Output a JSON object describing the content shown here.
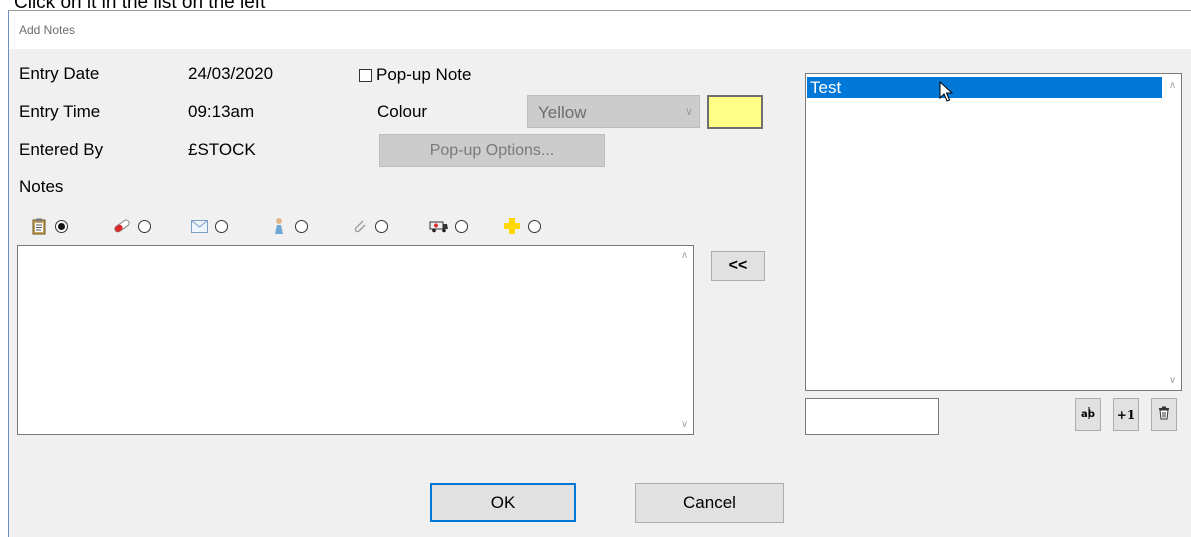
{
  "caption": "Click on it in the list on the left",
  "window": {
    "title": "Add Notes"
  },
  "fields": {
    "entry_date_label": "Entry Date",
    "entry_date_value": "24/03/2020",
    "entry_time_label": "Entry Time",
    "entry_time_value": "09:13am",
    "entered_by_label": "Entered By",
    "entered_by_value": "£STOCK",
    "notes_label": "Notes"
  },
  "popup": {
    "checkbox_label": "Pop-up Note",
    "checked": false,
    "colour_label": "Colour",
    "colour_value": "Yellow",
    "colour_swatch": "#ffff88",
    "options_label": "Pop-up Options..."
  },
  "categories": [
    {
      "icon": "clipboard-icon",
      "selected": true
    },
    {
      "icon": "pill-icon",
      "selected": false
    },
    {
      "icon": "envelope-icon",
      "selected": false
    },
    {
      "icon": "person-icon",
      "selected": false
    },
    {
      "icon": "paperclip-icon",
      "selected": false
    },
    {
      "icon": "ambulance-icon",
      "selected": false
    },
    {
      "icon": "yellow-cross-icon",
      "selected": false
    }
  ],
  "notes_text": "",
  "move_button_label": "<<",
  "list": {
    "items": [
      "Test"
    ],
    "selected_index": 0,
    "new_entry_value": ""
  },
  "list_buttons": {
    "add_label": "+1"
  },
  "buttons": {
    "ok": "OK",
    "cancel": "Cancel"
  },
  "colors": {
    "selection": "#0078d7",
    "dialog_bg": "#f0f0f0"
  }
}
